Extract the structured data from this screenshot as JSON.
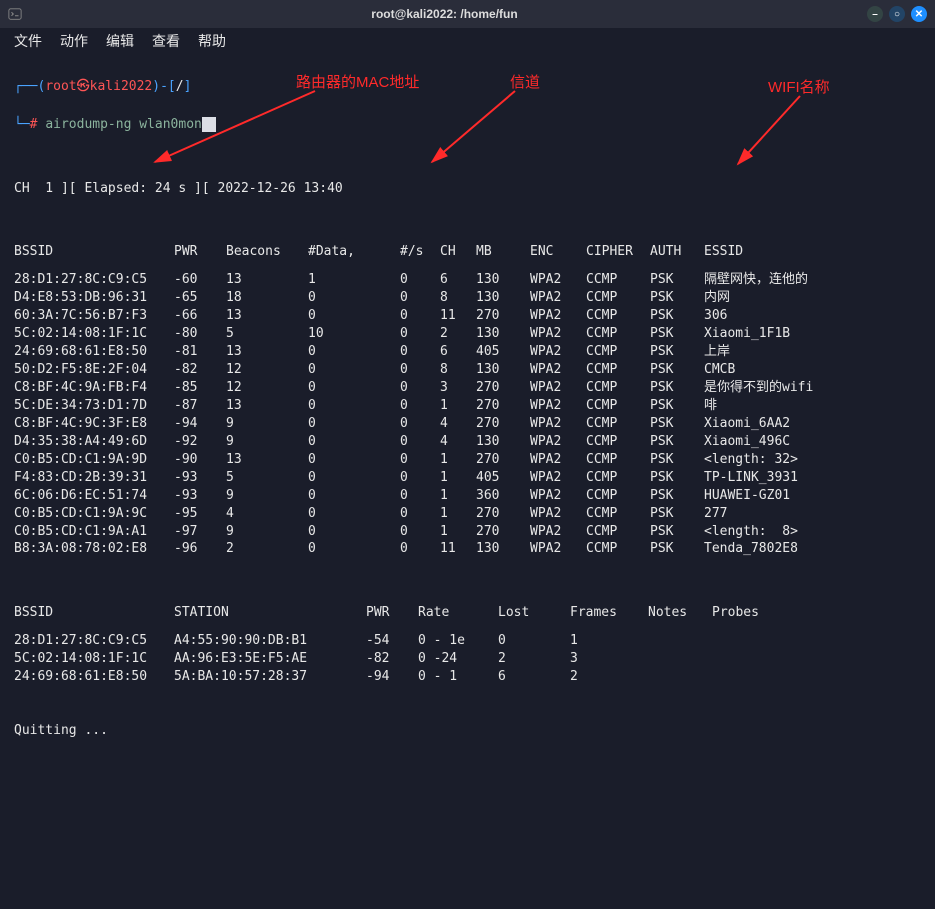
{
  "window": {
    "title": "root@kali2022: /home/fun",
    "icons": {
      "min": "–",
      "max": "○",
      "close": "✕"
    }
  },
  "menu": [
    "文件",
    "动作",
    "编辑",
    "查看",
    "帮助"
  ],
  "prompt": {
    "open": "┌──(",
    "user": "root",
    "at": "㉿",
    "host": "kali2022",
    "close": ")-[",
    "cwd": "/",
    "end": "]",
    "line2_prefix": "└─",
    "hash": "#",
    "command": "airodump-ng wlan0mon"
  },
  "status": "CH  1 ][ Elapsed: 24 s ][ 2022-12-26 13:40",
  "ap_headers": [
    "BSSID",
    "PWR",
    "Beacons",
    "#Data,",
    "#/s",
    "CH",
    "MB",
    "ENC",
    "CIPHER",
    "AUTH",
    "ESSID"
  ],
  "ap_rows": [
    {
      "bssid": "28:D1:27:8C:C9:C5",
      "pwr": "-60",
      "beacons": "13",
      "data": "1",
      "s": "0",
      "ch": "6",
      "mb": "130",
      "enc": "WPA2",
      "cipher": "CCMP",
      "auth": "PSK",
      "essid": "隔壁网快，连他的"
    },
    {
      "bssid": "D4:E8:53:DB:96:31",
      "pwr": "-65",
      "beacons": "18",
      "data": "0",
      "s": "0",
      "ch": "8",
      "mb": "130",
      "enc": "WPA2",
      "cipher": "CCMP",
      "auth": "PSK",
      "essid": "内网"
    },
    {
      "bssid": "60:3A:7C:56:B7:F3",
      "pwr": "-66",
      "beacons": "13",
      "data": "0",
      "s": "0",
      "ch": "11",
      "mb": "270",
      "enc": "WPA2",
      "cipher": "CCMP",
      "auth": "PSK",
      "essid": "306"
    },
    {
      "bssid": "5C:02:14:08:1F:1C",
      "pwr": "-80",
      "beacons": "5",
      "data": "10",
      "s": "0",
      "ch": "2",
      "mb": "130",
      "enc": "WPA2",
      "cipher": "CCMP",
      "auth": "PSK",
      "essid": "Xiaomi_1F1B"
    },
    {
      "bssid": "24:69:68:61:E8:50",
      "pwr": "-81",
      "beacons": "13",
      "data": "0",
      "s": "0",
      "ch": "6",
      "mb": "405",
      "enc": "WPA2",
      "cipher": "CCMP",
      "auth": "PSK",
      "essid": "上岸"
    },
    {
      "bssid": "50:D2:F5:8E:2F:04",
      "pwr": "-82",
      "beacons": "12",
      "data": "0",
      "s": "0",
      "ch": "8",
      "mb": "130",
      "enc": "WPA2",
      "cipher": "CCMP",
      "auth": "PSK",
      "essid": "CMCB"
    },
    {
      "bssid": "C8:BF:4C:9A:FB:F4",
      "pwr": "-85",
      "beacons": "12",
      "data": "0",
      "s": "0",
      "ch": "3",
      "mb": "270",
      "enc": "WPA2",
      "cipher": "CCMP",
      "auth": "PSK",
      "essid": "是你得不到的wifi"
    },
    {
      "bssid": "5C:DE:34:73:D1:7D",
      "pwr": "-87",
      "beacons": "13",
      "data": "0",
      "s": "0",
      "ch": "1",
      "mb": "270",
      "enc": "WPA2",
      "cipher": "CCMP",
      "auth": "PSK",
      "essid": "啡"
    },
    {
      "bssid": "C8:BF:4C:9C:3F:E8",
      "pwr": "-94",
      "beacons": "9",
      "data": "0",
      "s": "0",
      "ch": "4",
      "mb": "270",
      "enc": "WPA2",
      "cipher": "CCMP",
      "auth": "PSK",
      "essid": "Xiaomi_6AA2"
    },
    {
      "bssid": "D4:35:38:A4:49:6D",
      "pwr": "-92",
      "beacons": "9",
      "data": "0",
      "s": "0",
      "ch": "4",
      "mb": "130",
      "enc": "WPA2",
      "cipher": "CCMP",
      "auth": "PSK",
      "essid": "Xiaomi_496C"
    },
    {
      "bssid": "C0:B5:CD:C1:9A:9D",
      "pwr": "-90",
      "beacons": "13",
      "data": "0",
      "s": "0",
      "ch": "1",
      "mb": "270",
      "enc": "WPA2",
      "cipher": "CCMP",
      "auth": "PSK",
      "essid": "<length: 32>"
    },
    {
      "bssid": "F4:83:CD:2B:39:31",
      "pwr": "-93",
      "beacons": "5",
      "data": "0",
      "s": "0",
      "ch": "1",
      "mb": "405",
      "enc": "WPA2",
      "cipher": "CCMP",
      "auth": "PSK",
      "essid": "TP-LINK_3931"
    },
    {
      "bssid": "6C:06:D6:EC:51:74",
      "pwr": "-93",
      "beacons": "9",
      "data": "0",
      "s": "0",
      "ch": "1",
      "mb": "360",
      "enc": "WPA2",
      "cipher": "CCMP",
      "auth": "PSK",
      "essid": "HUAWEI-GZ01"
    },
    {
      "bssid": "C0:B5:CD:C1:9A:9C",
      "pwr": "-95",
      "beacons": "4",
      "data": "0",
      "s": "0",
      "ch": "1",
      "mb": "270",
      "enc": "WPA2",
      "cipher": "CCMP",
      "auth": "PSK",
      "essid": "277"
    },
    {
      "bssid": "C0:B5:CD:C1:9A:A1",
      "pwr": "-97",
      "beacons": "9",
      "data": "0",
      "s": "0",
      "ch": "1",
      "mb": "270",
      "enc": "WPA2",
      "cipher": "CCMP",
      "auth": "PSK",
      "essid": "<length:  8>"
    },
    {
      "bssid": "B8:3A:08:78:02:E8",
      "pwr": "-96",
      "beacons": "2",
      "data": "0",
      "s": "0",
      "ch": "11",
      "mb": "130",
      "enc": "WPA2",
      "cipher": "CCMP",
      "auth": "PSK",
      "essid": "Tenda_7802E8"
    }
  ],
  "sta_headers": [
    "BSSID",
    "STATION",
    "PWR",
    "Rate",
    "Lost",
    "Frames",
    "Notes",
    "Probes"
  ],
  "sta_rows": [
    {
      "bssid": "28:D1:27:8C:C9:C5",
      "station": "A4:55:90:90:DB:B1",
      "pwr": "-54",
      "rate": "0 - 1e",
      "lost": "0",
      "frames": "1",
      "notes": "",
      "probes": ""
    },
    {
      "bssid": "5C:02:14:08:1F:1C",
      "station": "AA:96:E3:5E:F5:AE",
      "pwr": "-82",
      "rate": "0 -24",
      "lost": "2",
      "frames": "3",
      "notes": "",
      "probes": ""
    },
    {
      "bssid": "24:69:68:61:E8:50",
      "station": "5A:BA:10:57:28:37",
      "pwr": "-94",
      "rate": "0 - 1",
      "lost": "6",
      "frames": "2",
      "notes": "",
      "probes": ""
    }
  ],
  "quitting": "Quitting ...",
  "annotations": {
    "mac": "路由器的MAC地址",
    "channel": "信道",
    "wifi_name": "WIFI名称"
  }
}
